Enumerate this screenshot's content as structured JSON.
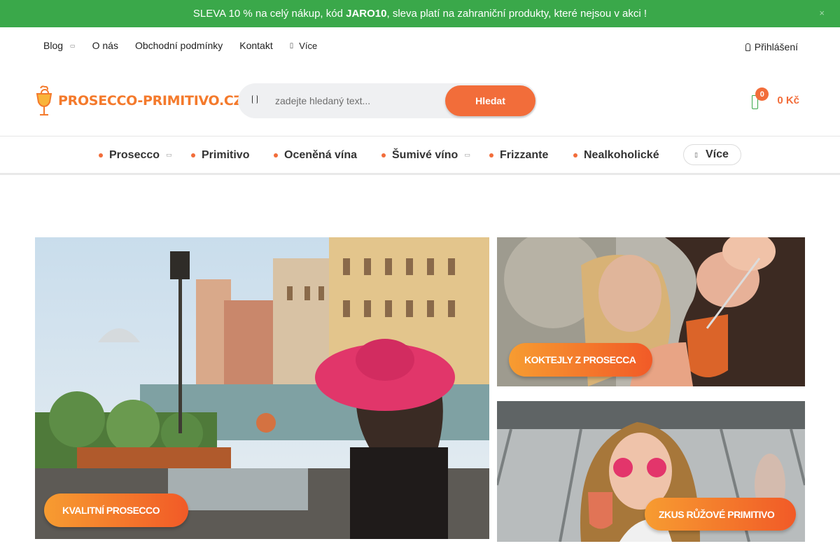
{
  "promo": {
    "text_before": "SLEVA 10 % na celý nákup, kód ",
    "code": "JARO10",
    "text_after": ", sleva platí na zahraniční produkty, které nejsou v akci !",
    "close_icon": "×"
  },
  "top_links": {
    "blog": "Blog",
    "about": "O nás",
    "terms": "Obchodní podmínky",
    "contact": "Kontakt",
    "more": "Více",
    "login": "Přihlášení"
  },
  "logo": {
    "text": "PROSECCO-PRIMITIVO.CZ"
  },
  "search": {
    "placeholder": "zadejte hledaný text...",
    "button": "Hledat"
  },
  "cart": {
    "count": "0",
    "total": "0 Kč"
  },
  "categories": {
    "items": [
      "Prosecco",
      "Primitivo",
      "Oceněná vína",
      "Šumivé víno",
      "Frizzante",
      "Nealkoholické"
    ],
    "more": "Více"
  },
  "banners": {
    "main": "KVALITNÍ PROSECCO",
    "top_right": "KOKTEJLY Z PROSECCA",
    "bottom_right": "ZKUS RŮŽOVÉ PRIMITIVO"
  },
  "colors": {
    "promo_green": "#3aa84a",
    "accent_orange": "#f26d3a",
    "logo_orange": "#f47a2c"
  },
  "icons": [
    "close-icon",
    "chevron-down-icon",
    "dots-icon",
    "user-icon",
    "search-icon",
    "cart-icon",
    "logo-icon"
  ]
}
